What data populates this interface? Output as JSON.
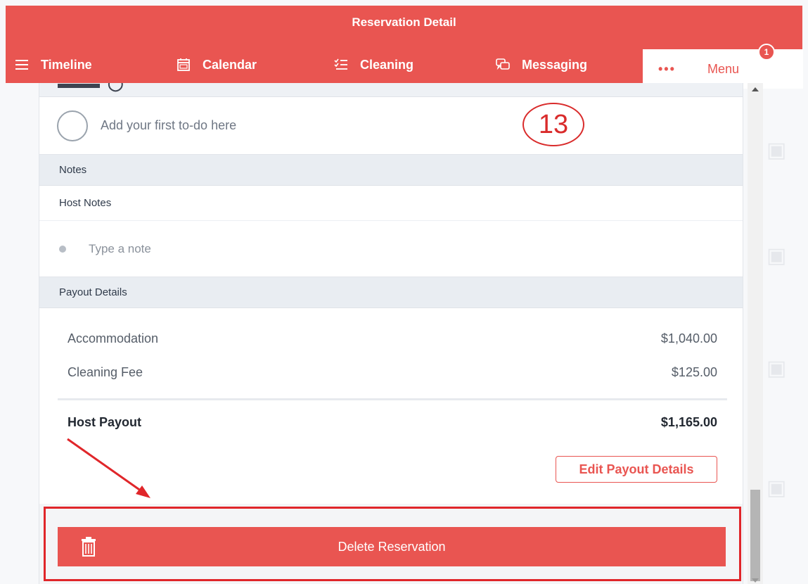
{
  "header": {
    "title": "Reservation Detail"
  },
  "tabs": [
    {
      "label": "Timeline",
      "icon": "list-icon"
    },
    {
      "label": "Calendar",
      "icon": "calendar-icon"
    },
    {
      "label": "Cleaning",
      "icon": "checklist-icon"
    },
    {
      "label": "Messaging",
      "icon": "chat-icon"
    }
  ],
  "menu": {
    "dots": "•••",
    "label": "Menu",
    "badge": "1"
  },
  "todo": {
    "placeholder": "Add your first to-do here"
  },
  "annotation": {
    "number": "13"
  },
  "notes": {
    "header": "Notes",
    "host_notes_label": "Host Notes",
    "placeholder": "Type a note"
  },
  "payout": {
    "header": "Payout Details",
    "items": [
      {
        "label": "Accommodation",
        "value": "$1,040.00"
      },
      {
        "label": "Cleaning Fee",
        "value": "$125.00"
      }
    ],
    "total_label": "Host Payout",
    "total_value": "$1,165.00",
    "edit_label": "Edit Payout Details"
  },
  "delete": {
    "label": "Delete Reservation",
    "icon": "trash-icon"
  },
  "colors": {
    "accent": "#e95551",
    "annotation": "#d92b2b",
    "section_bg": "#e9edf2"
  }
}
